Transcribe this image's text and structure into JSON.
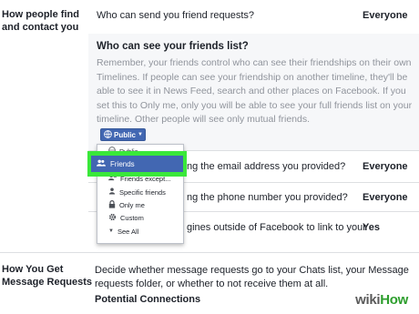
{
  "section1": {
    "title": "How people find and contact you",
    "rows": [
      {
        "question": "Who can send you friend requests?",
        "value": "Everyone"
      },
      {
        "question": "ng the email address you provided?",
        "value": "Everyone"
      },
      {
        "question": "ng the phone number you provided?",
        "value": "Everyone"
      },
      {
        "question": "gines outside of Facebook to link to your",
        "value": "Yes"
      }
    ]
  },
  "expanded": {
    "title": "Who can see your friends list?",
    "description": "Remember, your friends control who can see their friendships on their own Timelines. If people can see your friendship on another timeline, they'll be able to see it in News Feed, search and other places on Facebook. If you set this to Only me, only you will be able to see your full friends list on your timeline. Other people will see only mutual friends."
  },
  "audience_button": {
    "label": "Public"
  },
  "menu": {
    "items": [
      {
        "label": "Public",
        "icon": "globe-icon"
      },
      {
        "label": "Friends",
        "icon": "friends-icon"
      },
      {
        "label": "Friends except...",
        "icon": "friends-except-icon"
      },
      {
        "label": "Specific friends",
        "icon": "specific-friends-icon"
      },
      {
        "label": "Only me",
        "icon": "lock-icon"
      },
      {
        "label": "Custom",
        "icon": "gear-icon"
      },
      {
        "label": "See All",
        "icon": "chevron-down-icon"
      }
    ],
    "selected": "Friends"
  },
  "section2": {
    "title": "How You Get Message Requests",
    "description": "Decide whether message requests go to your Chats list, your Message requests folder, or whether to not receive them at all.",
    "subheading": "Potential Connections"
  },
  "watermark": {
    "wiki": "wiki",
    "how": "How"
  },
  "colors": {
    "highlight": "#3ae83a",
    "accent": "#4267b2"
  }
}
